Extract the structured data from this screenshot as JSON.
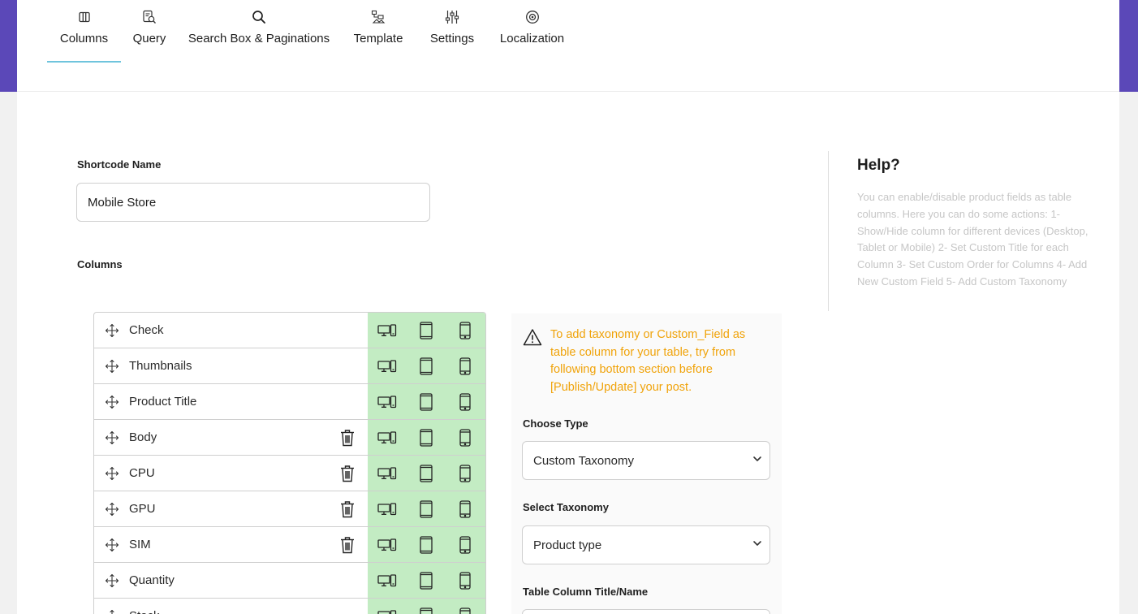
{
  "tabs": [
    {
      "id": "columns",
      "label": "Columns",
      "icon": "columns-icon",
      "active": true
    },
    {
      "id": "query",
      "label": "Query",
      "icon": "query-icon",
      "active": false
    },
    {
      "id": "search",
      "label": "Search Box & Paginations",
      "icon": "search-icon",
      "active": false
    },
    {
      "id": "template",
      "label": "Template",
      "icon": "template-icon",
      "active": false
    },
    {
      "id": "settings",
      "label": "Settings",
      "icon": "sliders-icon",
      "active": false
    },
    {
      "id": "localization",
      "label": "Localization",
      "icon": "target-icon",
      "active": false
    }
  ],
  "shortcode": {
    "label": "Shortcode Name",
    "value": "Mobile Store"
  },
  "columns_section": {
    "label": "Columns"
  },
  "columns": [
    {
      "name": "Check",
      "deletable": false
    },
    {
      "name": "Thumbnails",
      "deletable": false
    },
    {
      "name": "Product Title",
      "deletable": false
    },
    {
      "name": "Body",
      "deletable": true
    },
    {
      "name": "CPU",
      "deletable": true
    },
    {
      "name": "GPU",
      "deletable": true
    },
    {
      "name": "SIM",
      "deletable": true
    },
    {
      "name": "Quantity",
      "deletable": false
    },
    {
      "name": "Stock",
      "deletable": false
    }
  ],
  "panel": {
    "warning": "To add taxonomy or Custom_Field as table column for your table, try from following bottom section before [Publish/Update] your post.",
    "choose_type_label": "Choose Type",
    "choose_type_value": "Custom Taxonomy",
    "select_taxonomy_label": "Select Taxonomy",
    "select_taxonomy_value": "Product type",
    "column_title_label": "Table Column Title/Name"
  },
  "help": {
    "title": "Help?",
    "text": "You can enable/disable product fields as table columns. Here you can do some actions: 1- Show/Hide column for different devices (Desktop, Tablet or Mobile) 2- Set Custom Title for each Column 3- Set Custom Order for Columns 4- Add New Custom Field 5- Add Custom Taxonomy"
  },
  "colors": {
    "accent": "#6fc4dd",
    "brand": "#5b48b8",
    "device_bg": "#c3ecc3",
    "warning": "#f0a30a",
    "help_text": "#c6c6c6"
  }
}
